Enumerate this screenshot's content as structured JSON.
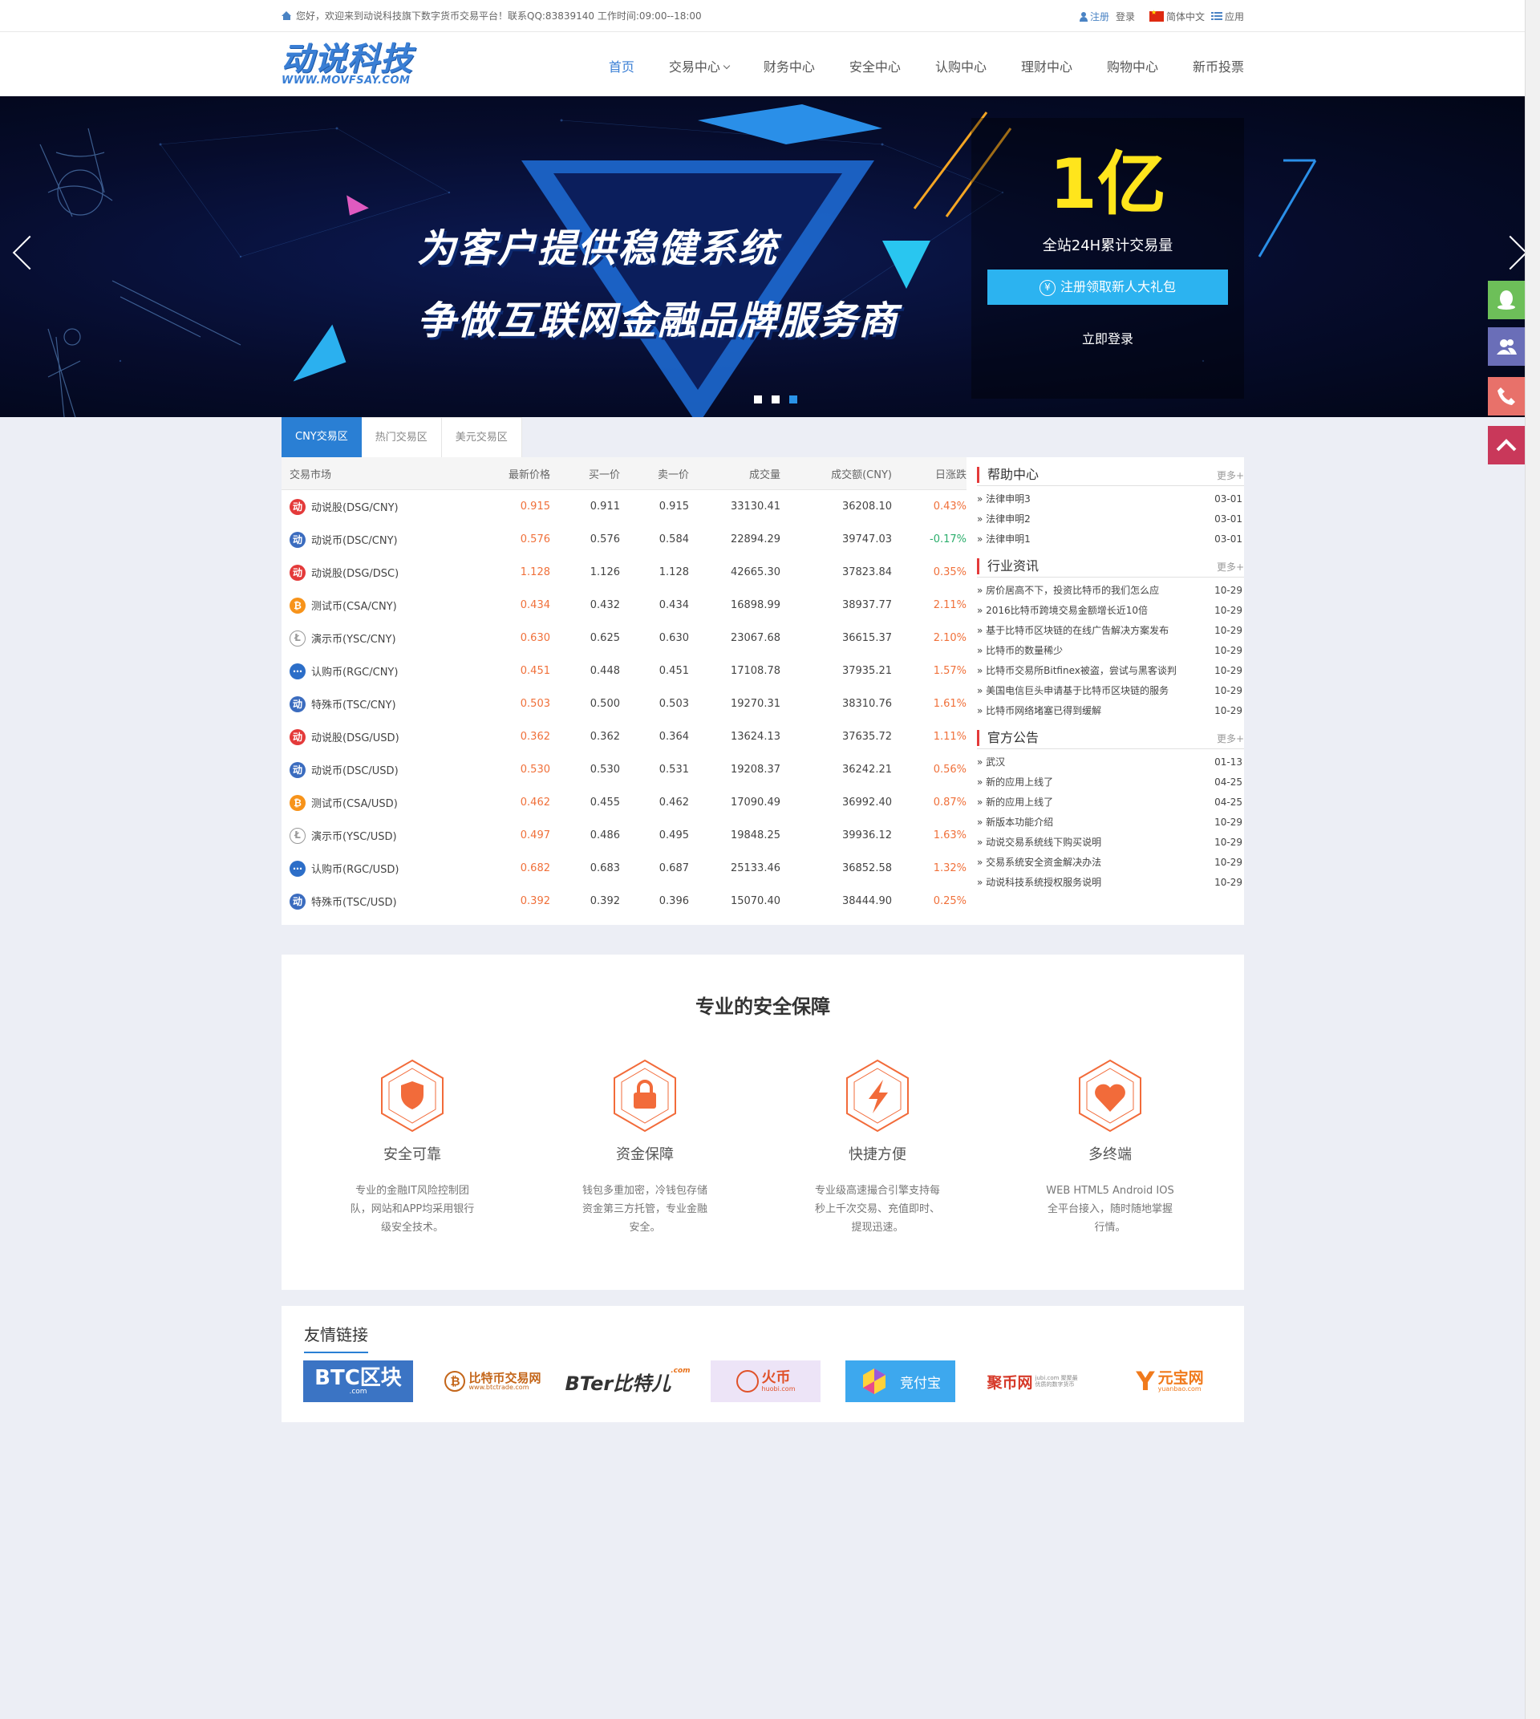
{
  "topbar": {
    "welcome": "您好，欢迎来到动说科技旗下数字货币交易平台！联系QQ:83839140 工作时间:09:00--18:00",
    "register": "注册",
    "login": "登录",
    "language": "简体中文",
    "apps": "应用"
  },
  "header": {
    "logo_main": "动说科技",
    "logo_sub": "WWW.MOVFSAY.COM",
    "nav": [
      "首页",
      "交易中心",
      "财务中心",
      "安全中心",
      "认购中心",
      "理财中心",
      "购物中心",
      "新币投票"
    ]
  },
  "banner": {
    "line1": "为客户提供稳健系统",
    "line2": "争做互联网金融品牌服务商",
    "promo_value": "1亿",
    "promo_label": "全站24H累计交易量",
    "promo_button": "注册领取新人大礼包",
    "promo_login": "立即登录"
  },
  "market": {
    "tabs": [
      "CNY交易区",
      "热门交易区",
      "美元交易区"
    ],
    "columns": [
      "交易市场",
      "最新价格",
      "买一价",
      "卖一价",
      "成交量",
      "成交额(CNY)",
      "日涨跌"
    ],
    "rows": [
      {
        "icon": "动",
        "color": "red",
        "name": "动说股(DSG/CNY)",
        "price": "0.915",
        "buy": "0.911",
        "sell": "0.915",
        "volume": "33130.41",
        "amount": "36208.10",
        "change": "0.43%",
        "dir": "up"
      },
      {
        "icon": "动",
        "color": "blue",
        "name": "动说币(DSC/CNY)",
        "price": "0.576",
        "buy": "0.576",
        "sell": "0.584",
        "volume": "22894.29",
        "amount": "39747.03",
        "change": "-0.17%",
        "dir": "down"
      },
      {
        "icon": "动",
        "color": "red",
        "name": "动说股(DSG/DSC)",
        "price": "1.128",
        "buy": "1.126",
        "sell": "1.128",
        "volume": "42665.30",
        "amount": "37823.84",
        "change": "0.35%",
        "dir": "up"
      },
      {
        "icon": "₿",
        "color": "orange",
        "name": "测试币(CSA/CNY)",
        "price": "0.434",
        "buy": "0.432",
        "sell": "0.434",
        "volume": "16898.99",
        "amount": "38937.77",
        "change": "2.11%",
        "dir": "up"
      },
      {
        "icon": "Ł",
        "color": "grey",
        "name": "演示币(YSC/CNY)",
        "price": "0.630",
        "buy": "0.625",
        "sell": "0.630",
        "volume": "23067.68",
        "amount": "36615.37",
        "change": "2.10%",
        "dir": "up"
      },
      {
        "icon": "⋯",
        "color": "net",
        "name": "认购币(RGC/CNY)",
        "price": "0.451",
        "buy": "0.448",
        "sell": "0.451",
        "volume": "17108.78",
        "amount": "37935.21",
        "change": "1.57%",
        "dir": "up"
      },
      {
        "icon": "动",
        "color": "blue",
        "name": "特殊币(TSC/CNY)",
        "price": "0.503",
        "buy": "0.500",
        "sell": "0.503",
        "volume": "19270.31",
        "amount": "38310.76",
        "change": "1.61%",
        "dir": "up"
      },
      {
        "icon": "动",
        "color": "red",
        "name": "动说股(DSG/USD)",
        "price": "0.362",
        "buy": "0.362",
        "sell": "0.364",
        "volume": "13624.13",
        "amount": "37635.72",
        "change": "1.11%",
        "dir": "up"
      },
      {
        "icon": "动",
        "color": "blue",
        "name": "动说币(DSC/USD)",
        "price": "0.530",
        "buy": "0.530",
        "sell": "0.531",
        "volume": "19208.37",
        "amount": "36242.21",
        "change": "0.56%",
        "dir": "up"
      },
      {
        "icon": "₿",
        "color": "orange",
        "name": "测试币(CSA/USD)",
        "price": "0.462",
        "buy": "0.455",
        "sell": "0.462",
        "volume": "17090.49",
        "amount": "36992.40",
        "change": "0.87%",
        "dir": "up"
      },
      {
        "icon": "Ł",
        "color": "grey",
        "name": "演示币(YSC/USD)",
        "price": "0.497",
        "buy": "0.486",
        "sell": "0.495",
        "volume": "19848.25",
        "amount": "39936.12",
        "change": "1.63%",
        "dir": "up"
      },
      {
        "icon": "⋯",
        "color": "net",
        "name": "认购币(RGC/USD)",
        "price": "0.682",
        "buy": "0.683",
        "sell": "0.687",
        "volume": "25133.46",
        "amount": "36852.58",
        "change": "1.32%",
        "dir": "up"
      },
      {
        "icon": "动",
        "color": "blue",
        "name": "特殊币(TSC/USD)",
        "price": "0.392",
        "buy": "0.392",
        "sell": "0.396",
        "volume": "15070.40",
        "amount": "38444.90",
        "change": "0.25%",
        "dir": "up"
      }
    ]
  },
  "news": [
    {
      "title": "帮助中心",
      "more": "更多+",
      "items": [
        {
          "text": "» 法律申明3",
          "date": "03-01"
        },
        {
          "text": "» 法律申明2",
          "date": "03-01"
        },
        {
          "text": "» 法律申明1",
          "date": "03-01"
        }
      ]
    },
    {
      "title": "行业资讯",
      "more": "更多+",
      "items": [
        {
          "text": "» 房价居高不下，投资比特币的我们怎么应",
          "date": "10-29"
        },
        {
          "text": "» 2016比特币跨境交易金额增长近10倍",
          "date": "10-29"
        },
        {
          "text": "» 基于比特币区块链的在线广告解决方案发布",
          "date": "10-29"
        },
        {
          "text": "» 比特币的数量稀少",
          "date": "10-29"
        },
        {
          "text": "» 比特币交易所Bitfinex被盗，尝试与黑客谈判",
          "date": "10-29"
        },
        {
          "text": "» 美国电信巨头申请基于比特币区块链的服务",
          "date": "10-29"
        },
        {
          "text": "» 比特币网络堵塞已得到缓解",
          "date": "10-29"
        }
      ]
    },
    {
      "title": "官方公告",
      "more": "更多+",
      "items": [
        {
          "text": "» 武汉",
          "date": "01-13"
        },
        {
          "text": "» 新的应用上线了",
          "date": "04-25"
        },
        {
          "text": "» 新的应用上线了",
          "date": "04-25"
        },
        {
          "text": "» 新版本功能介绍",
          "date": "10-29"
        },
        {
          "text": "» 动说交易系统线下购买说明",
          "date": "10-29"
        },
        {
          "text": "» 交易系统安全资金解决办法",
          "date": "10-29"
        },
        {
          "text": "» 动说科技系统授权服务说明",
          "date": "10-29"
        }
      ]
    }
  ],
  "security": {
    "title": "专业的安全保障",
    "features": [
      {
        "title": "安全可靠",
        "desc": "专业的金融IT风险控制团队，网站和APP均采用银行级安全技术。"
      },
      {
        "title": "资金保障",
        "desc": "钱包多重加密，冷钱包存储资金第三方托管，专业金融安全。"
      },
      {
        "title": "快捷方便",
        "desc": "专业级高速撮合引擎支持每秒上千次交易、充值即时、提现迅速。"
      },
      {
        "title": "多终端",
        "desc": "WEB HTML5 Android IOS全平台接入，随时随地掌握行情。"
      }
    ]
  },
  "links": {
    "title": "友情链接",
    "partners": [
      {
        "name": "BTC区块",
        "sub": ".com"
      },
      {
        "name": "比特币交易网",
        "sub": "www.btctrade.com"
      },
      {
        "name": "BTer比特儿",
        "sub": ".com"
      },
      {
        "name": "火币",
        "sub": "huobi.com"
      },
      {
        "name": "竞付宝",
        "sub": ""
      },
      {
        "name": "聚币网",
        "sub": "jubi.com 聚聚最优质的数字货币"
      },
      {
        "name": "元宝网",
        "sub": "yuanbao.com"
      }
    ]
  },
  "colors": {
    "accent": "#2a7fd4",
    "up": "#f0703a",
    "down": "#2bae6c",
    "feature_orange": "#f26b3a"
  }
}
